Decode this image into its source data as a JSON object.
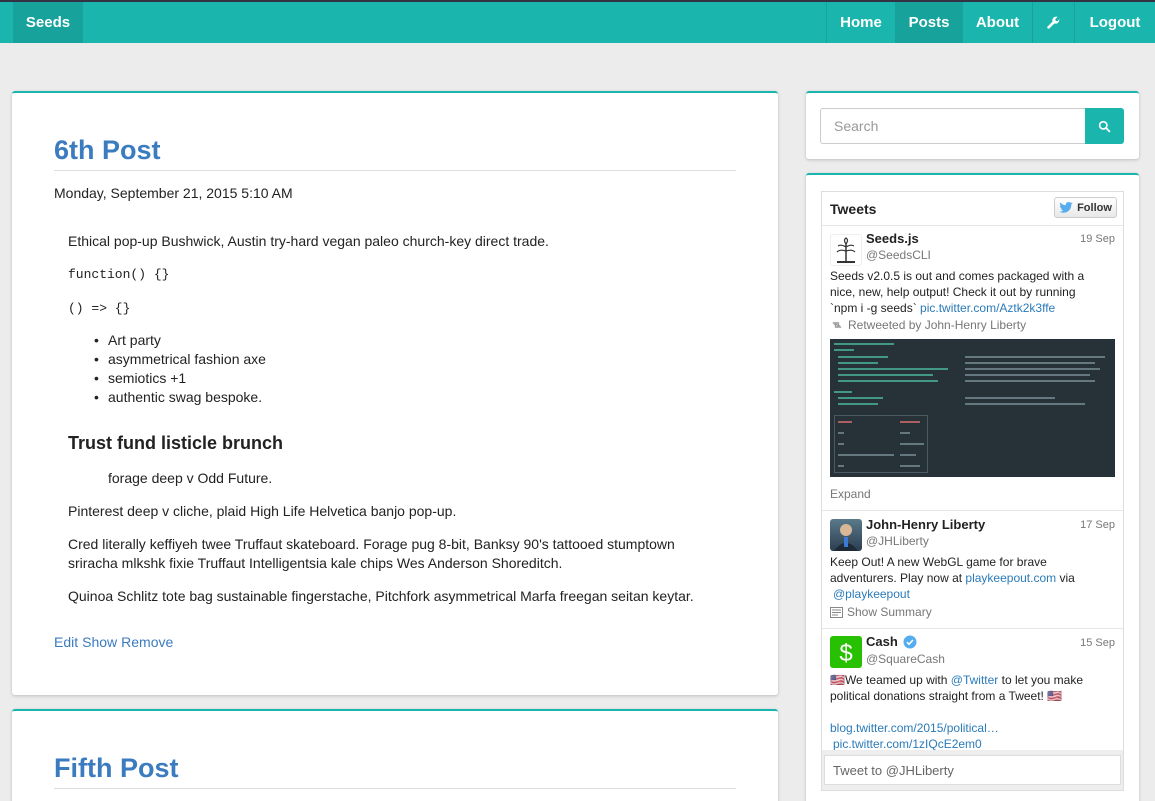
{
  "navbar": {
    "brand": "Seeds",
    "items": [
      {
        "label": "Home"
      },
      {
        "label": "Posts"
      },
      {
        "label": "About"
      },
      {
        "label": "Logout"
      }
    ],
    "settings_icon": "wrench-icon"
  },
  "post1": {
    "title": "6th Post",
    "date": "Monday, September 21, 2015 5:10 AM",
    "p1": "Ethical pop-up Bushwick, Austin try-hard vegan paleo church-key direct trade.",
    "code1": "function() {}",
    "code2": "() => {}",
    "list": [
      "Art party",
      "asymmetrical fashion axe",
      "semiotics +1",
      "authentic swag bespoke."
    ],
    "heading": "Trust fund listicle brunch",
    "quote": "forage deep v Odd Future.",
    "p2": "Pinterest deep v cliche, plaid High Life Helvetica banjo pop-up.",
    "p3_line1": "Cred literally keffiyeh twee Truffaut skateboard. Forage pug 8-bit, Banksy 90's tattooed stumptown",
    "p3_line2": "sriracha mlkshk fixie Truffaut Intelligentsia kale chips Wes Anderson Shoreditch.",
    "p4": "Quinoa Schlitz tote bag sustainable fingerstache, Pitchfork asymmetrical Marfa freegan seitan keytar.",
    "actions": {
      "edit": "Edit",
      "show": "Show",
      "remove": "Remove"
    }
  },
  "post2": {
    "title": "Fifth Post"
  },
  "search": {
    "placeholder": "Search",
    "icon": "search-icon"
  },
  "tweets": {
    "title": "Tweets",
    "follow_label": "Follow",
    "items": [
      {
        "name": "Seeds.js",
        "handle": "@SeedsCLI",
        "date": "19 Sep",
        "text1": "Seeds v2.0.5 is out and comes packaged with a",
        "text2": "nice, new, help output! Check it out by running",
        "text3": "`npm i -g seeds`",
        "link": "pic.twitter.com/Aztk2k3ffe",
        "retweet": "Retweeted by John-Henry Liberty",
        "expand": "Expand"
      },
      {
        "name": "John-Henry Liberty",
        "handle": "@JHLiberty",
        "date": "17 Sep",
        "text1": "Keep Out! A new WebGL game for brave",
        "text2a": "adventurers. Play now at ",
        "link1": "playkeepout.com",
        "text2b": " via",
        "link2": "@playkeepout",
        "summary": "Show Summary"
      },
      {
        "name": "Cash",
        "handle": "@SquareCash",
        "date": "15 Sep",
        "text1a": "🇺🇸We teamed up with ",
        "link1": "@Twitter",
        "text1b": " to let you make",
        "text2": "political donations straight from a Tweet! 🇺🇸",
        "link2": "blog.twitter.com/2015/political…",
        "link3": "pic.twitter.com/1zIQcE2em0"
      }
    ],
    "tweet_to": "Tweet to @JHLiberty"
  },
  "colors": {
    "accent": "#1ab5ac",
    "link": "#3b7bbf",
    "twitter_link": "#2b7bb9"
  }
}
